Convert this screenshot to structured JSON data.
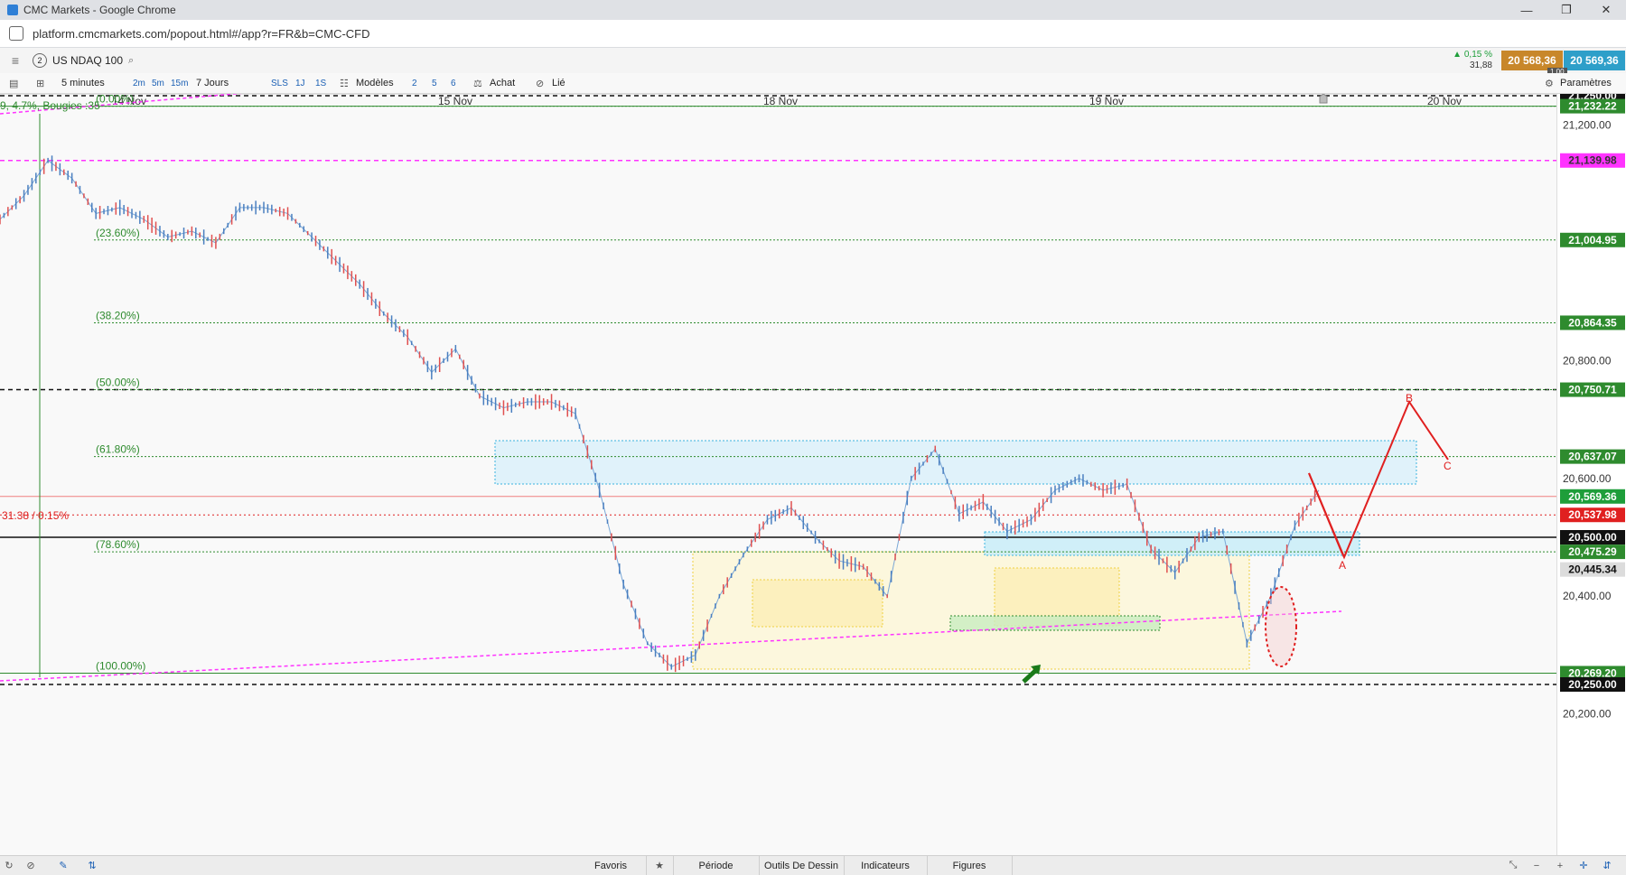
{
  "window": {
    "title": "CMC Markets - Google Chrome",
    "url": "platform.cmcmarkets.com/popout.html#/app?r=FR&b=CMC-CFD",
    "controls": [
      "—",
      "❐",
      "✕"
    ]
  },
  "instrument": {
    "badge": "2",
    "name": "US NDAQ 100",
    "change_pct": "0,15 %",
    "change_pts": "31,88",
    "sell_price": "20 568,36",
    "buy_price": "20 569,36",
    "spread": "1,00",
    "settings_label": "Paramètres"
  },
  "toolbar": {
    "interval": "5 minutes",
    "interval_buttons": [
      "2m",
      "5m",
      "15m"
    ],
    "range": "7 Jours",
    "range_buttons": [
      "SLS",
      "1J",
      "1S"
    ],
    "models_label": "Modèles",
    "num_buttons": [
      "2",
      "5",
      "6"
    ],
    "buy_label": "Achat",
    "linked_label": "Lié"
  },
  "date_labels": [
    "14 Nov",
    "15 Nov",
    "18 Nov",
    "19 Nov",
    "20 Nov"
  ],
  "chart_data": {
    "type": "line",
    "title": "",
    "xlabel": "",
    "ylabel": "",
    "ylim": [
      20140,
      21270
    ],
    "x_dates": [
      "14 Nov",
      "15 Nov",
      "18 Nov",
      "19 Nov",
      "20 Nov"
    ],
    "series": [
      {
        "values": [
          21040,
          21080,
          21140,
          21110,
          21050,
          21060,
          21040,
          21010,
          21020,
          21000,
          21060,
          21060,
          21050,
          21010,
          20970,
          20930,
          20880,
          20840,
          20780,
          20820,
          20740,
          20720,
          20730,
          20730,
          20710,
          20580,
          20420,
          20320,
          20280,
          20300,
          20400,
          20470,
          20530,
          20550,
          20500,
          20460,
          20450,
          20400,
          20600,
          20650,
          20540,
          20560,
          20510,
          20530,
          20580,
          20600,
          20580,
          20590,
          20480,
          20440,
          20500,
          20510,
          20320,
          20400,
          20520,
          20580
        ]
      }
    ],
    "price_ticks": [
      "21,200.00",
      "20,800.00",
      "20,600.00",
      "20,400.00",
      "20,200.00"
    ],
    "price_tick_values": [
      21200,
      20800,
      20600,
      20400,
      20200
    ],
    "price_labels": [
      {
        "text": "21,250.00",
        "value": 21250,
        "bg": "#111111",
        "fg": "#ffffff"
      },
      {
        "text": "21,232.22",
        "value": 21232.22,
        "bg": "#2e8b2e",
        "fg": "#ffffff"
      },
      {
        "text": "21,139.98",
        "value": 21139.98,
        "bg": "#ff33ff",
        "fg": "#333333"
      },
      {
        "text": "21,004.95",
        "value": 21004.95,
        "bg": "#2e8b2e",
        "fg": "#ffffff"
      },
      {
        "text": "20,864.35",
        "value": 20864.35,
        "bg": "#2e8b2e",
        "fg": "#ffffff"
      },
      {
        "text": "20,750.71",
        "value": 20750.71,
        "bg": "#2e8b2e",
        "fg": "#ffffff"
      },
      {
        "text": "20,637.07",
        "value": 20637.07,
        "bg": "#2e8b2e",
        "fg": "#ffffff"
      },
      {
        "text": "20,569.36",
        "value": 20569.36,
        "bg": "#1e9e3a",
        "fg": "#ffffff"
      },
      {
        "text": "20,537.98",
        "value": 20537.98,
        "bg": "#e02020",
        "fg": "#ffffff"
      },
      {
        "text": "20,500.00",
        "value": 20500,
        "bg": "#111111",
        "fg": "#ffffff"
      },
      {
        "text": "20,475.29",
        "value": 20475.29,
        "bg": "#2e8b2e",
        "fg": "#ffffff"
      },
      {
        "text": "20,445.34",
        "value": 20445.34,
        "bg": "#dcdcdc",
        "fg": "#111111"
      },
      {
        "text": "20,269.20",
        "value": 20269.2,
        "bg": "#2e8b2e",
        "fg": "#ffffff"
      },
      {
        "text": "20,250.00",
        "value": 20250,
        "bg": "#111111",
        "fg": "#ffffff"
      }
    ],
    "fib_levels": [
      {
        "label": "(0.00%)",
        "value": 21232.22
      },
      {
        "label": "(23.60%)",
        "value": 21004.95
      },
      {
        "label": "(38.20%)",
        "value": 20864.35
      },
      {
        "label": "(50.00%)",
        "value": 20750.71
      },
      {
        "label": "(61.80%)",
        "value": 20637.07
      },
      {
        "label": "(78.60%)",
        "value": 20475.29
      },
      {
        "label": "(100.00%)",
        "value": 20269.2
      }
    ],
    "annotations": {
      "measure_text": "9, 4.7%, Bougies :35",
      "change_text": "31.38 / 0.15%",
      "wave_labels": [
        "A",
        "B",
        "C"
      ]
    }
  },
  "bottom": {
    "tabs": [
      "Favoris",
      "Période",
      "Outils De Dessin",
      "Indicateurs",
      "Figures"
    ]
  },
  "colors": {
    "fib_green": "#2e8b2e",
    "magenta": "#ff33ff",
    "red": "#e02020",
    "zone_blue": "#d6f0fb",
    "zone_yellow": "#fdf5c9"
  }
}
